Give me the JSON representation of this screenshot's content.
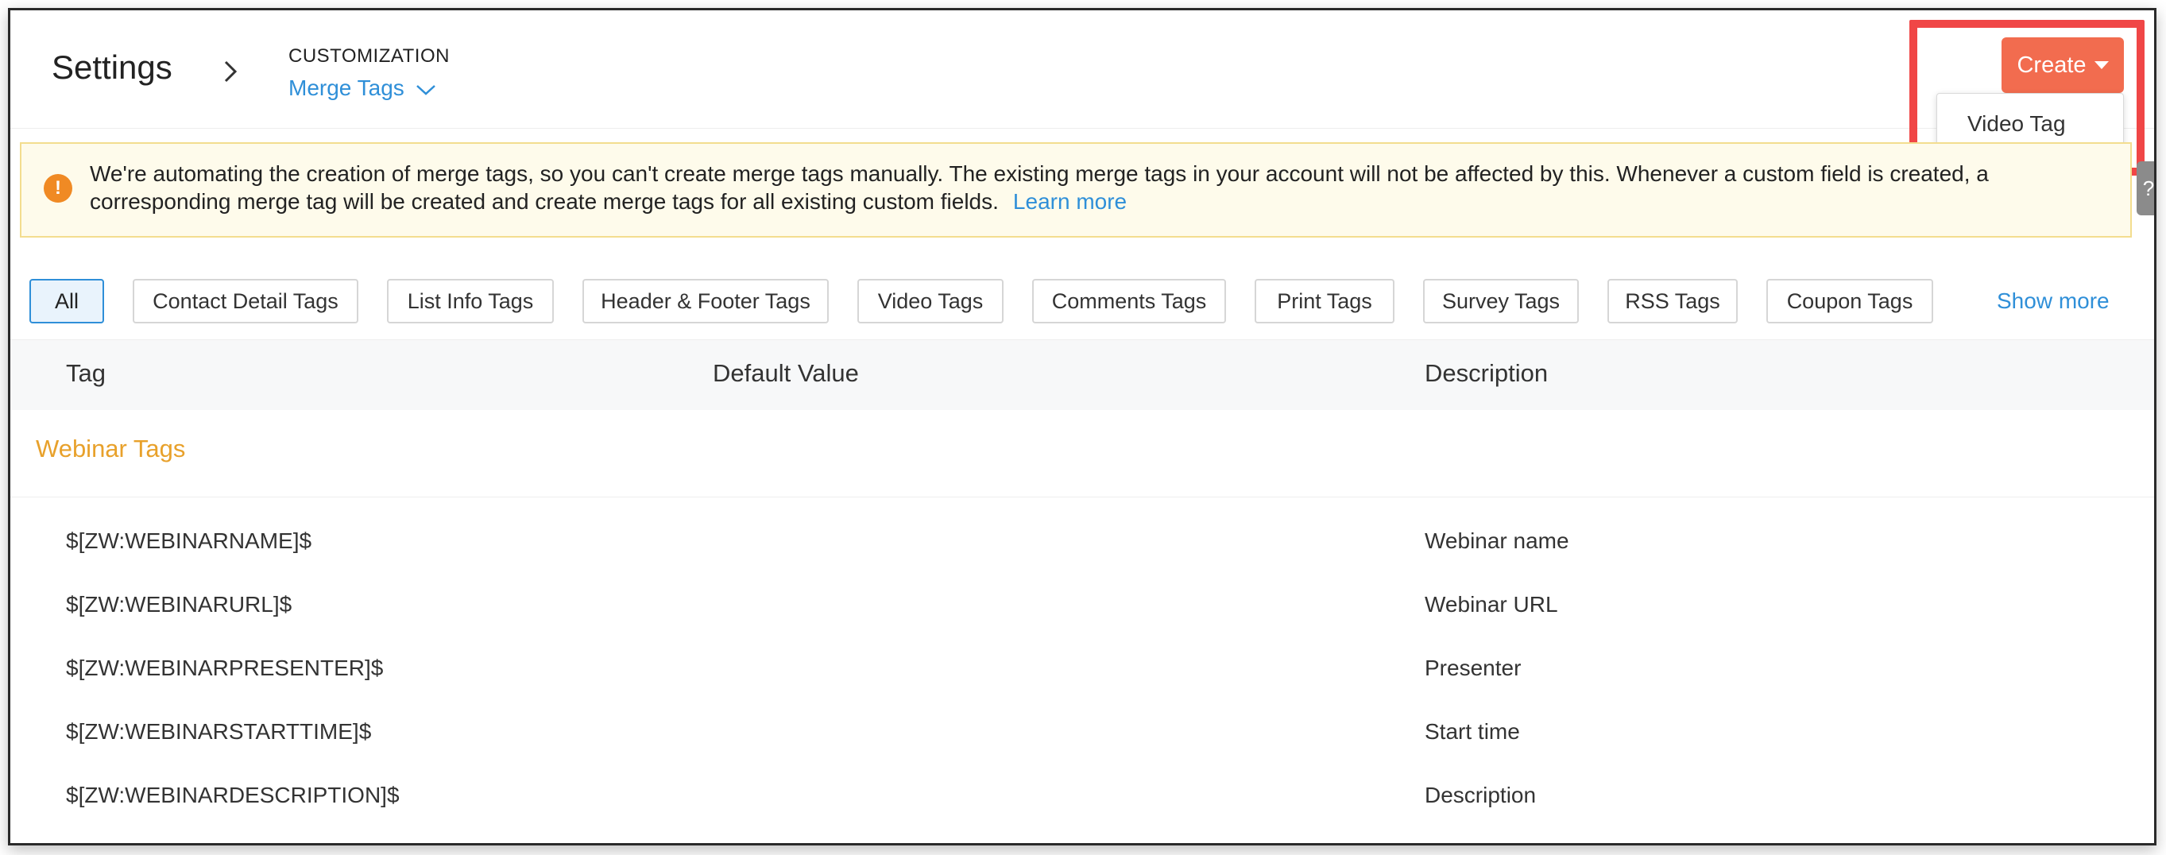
{
  "header": {
    "title": "Settings",
    "breadcrumb_section": "CUSTOMIZATION",
    "breadcrumb_current": "Merge Tags",
    "create_label": "Create",
    "dropdown_items": [
      "Video Tag"
    ]
  },
  "alert": {
    "message": "We're automating the creation of merge tags, so you can't create merge tags manually. The existing merge tags in your account will not be affected by this. Whenever a custom field is created, a corresponding merge tag will be created and create merge tags for all existing custom fields.",
    "link": "Learn more"
  },
  "filters": {
    "chips": [
      "All",
      "Contact Detail Tags",
      "List Info Tags",
      "Header & Footer Tags",
      "Video Tags",
      "Comments Tags",
      "Print Tags",
      "Survey Tags",
      "RSS Tags",
      "Coupon Tags"
    ],
    "active": "All",
    "show_more": "Show more"
  },
  "table": {
    "columns": [
      "Tag",
      "Default Value",
      "Description"
    ],
    "group": "Webinar Tags",
    "rows": [
      {
        "tag": "$[ZW:WEBINARNAME]$",
        "default": "",
        "description": "Webinar name"
      },
      {
        "tag": "$[ZW:WEBINARURL]$",
        "default": "",
        "description": "Webinar URL"
      },
      {
        "tag": "$[ZW:WEBINARPRESENTER]$",
        "default": "",
        "description": "Presenter"
      },
      {
        "tag": "$[ZW:WEBINARSTARTTIME]$",
        "default": "",
        "description": "Start time"
      },
      {
        "tag": "$[ZW:WEBINARDESCRIPTION]$",
        "default": "",
        "description": "Description"
      }
    ]
  },
  "colors": {
    "accent_blue": "#2f8fd8",
    "create_orange": "#f26c4f",
    "group_orange": "#e8a12b",
    "highlight_red": "#f04646",
    "alert_bg": "#fefbeb"
  }
}
